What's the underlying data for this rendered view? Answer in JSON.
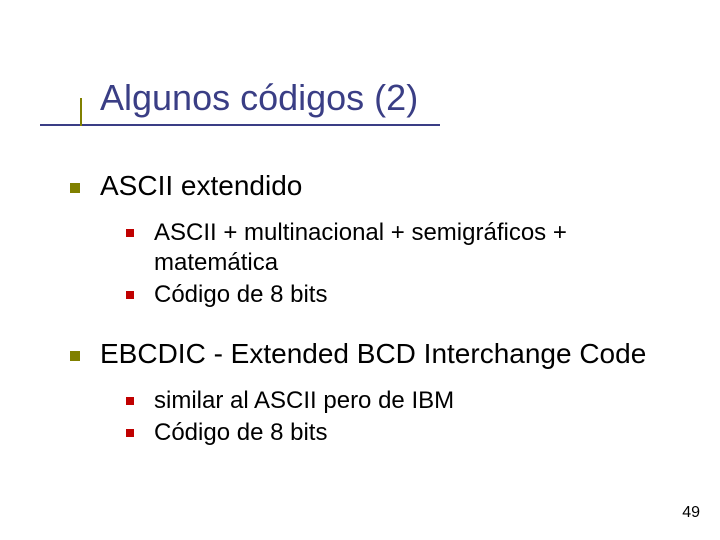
{
  "title": "Algunos códigos (2)",
  "sections": [
    {
      "heading": "ASCII extendido",
      "items": [
        "ASCII + multinacional + semigráficos + matemática",
        "Código de 8 bits"
      ]
    },
    {
      "heading": "EBCDIC - Extended BCD Interchange Code",
      "items": [
        "similar al ASCII pero de IBM",
        "Código de 8 bits"
      ]
    }
  ],
  "page_number": "49"
}
